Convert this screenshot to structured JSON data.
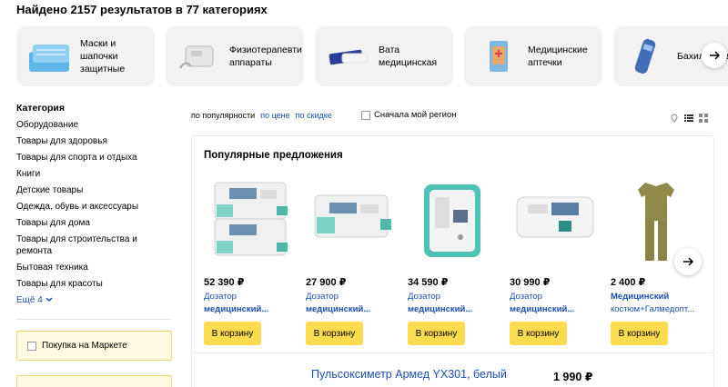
{
  "results": {
    "title": "Найдено 2157 результатов в 77 категориях"
  },
  "categories": [
    {
      "label": "Маски и шапочки защитные",
      "icon": "masks-icon"
    },
    {
      "label": "Физиотерапевти аппараты",
      "icon": "physio-device-icon"
    },
    {
      "label": "Вата медицинская",
      "icon": "cotton-wool-icon"
    },
    {
      "label": "Медицинские аптечки",
      "icon": "first-aid-kit-icon"
    },
    {
      "label": "Бахилы медици",
      "icon": "shoe-covers-icon"
    }
  ],
  "sidebar": {
    "heading": "Категория",
    "items": [
      "Оборудование",
      "Товары для здоровья",
      "Товары для спорта и отдыха",
      "Книги",
      "Детские товары",
      "Одежда, обувь и аксессуары",
      "Товары для дома",
      "Товары для строительства и ремонта",
      "Бытовая техника",
      "Товары для красоты"
    ],
    "more": "Ещё 4"
  },
  "filters": {
    "market_purchase": "Покупка на Маркете"
  },
  "sort": {
    "popularity": "по популярности",
    "price": "по цене",
    "discount": "по скидке",
    "region": "Сначала мой регион"
  },
  "offers": {
    "title": "Популярные предложения",
    "button_label": "В корзину",
    "items": [
      {
        "price": "52 390 ₽",
        "line1": "Дозатор",
        "line2": "медицинский..."
      },
      {
        "price": "27 900 ₽",
        "line1": "Дозатор",
        "line2": "медицинский..."
      },
      {
        "price": "34 590 ₽",
        "line1": "Дозатор",
        "line2": "медицинский..."
      },
      {
        "price": "30 990 ₽",
        "line1": "Дозатор",
        "line2": "медицинский..."
      },
      {
        "price": "2 400 ₽",
        "line1": "Медицинский",
        "line2": "костюм+Галмедопт..."
      }
    ]
  },
  "listing": {
    "title": "Пульсоксиметр Армед YX301, белый",
    "price": "1 990 ₽"
  },
  "colors": {
    "accent_button": "#ffdb4d",
    "link": "#1a4fb3",
    "card_bg": "#f2f2f2",
    "filter_bg": "#fffbe0"
  }
}
